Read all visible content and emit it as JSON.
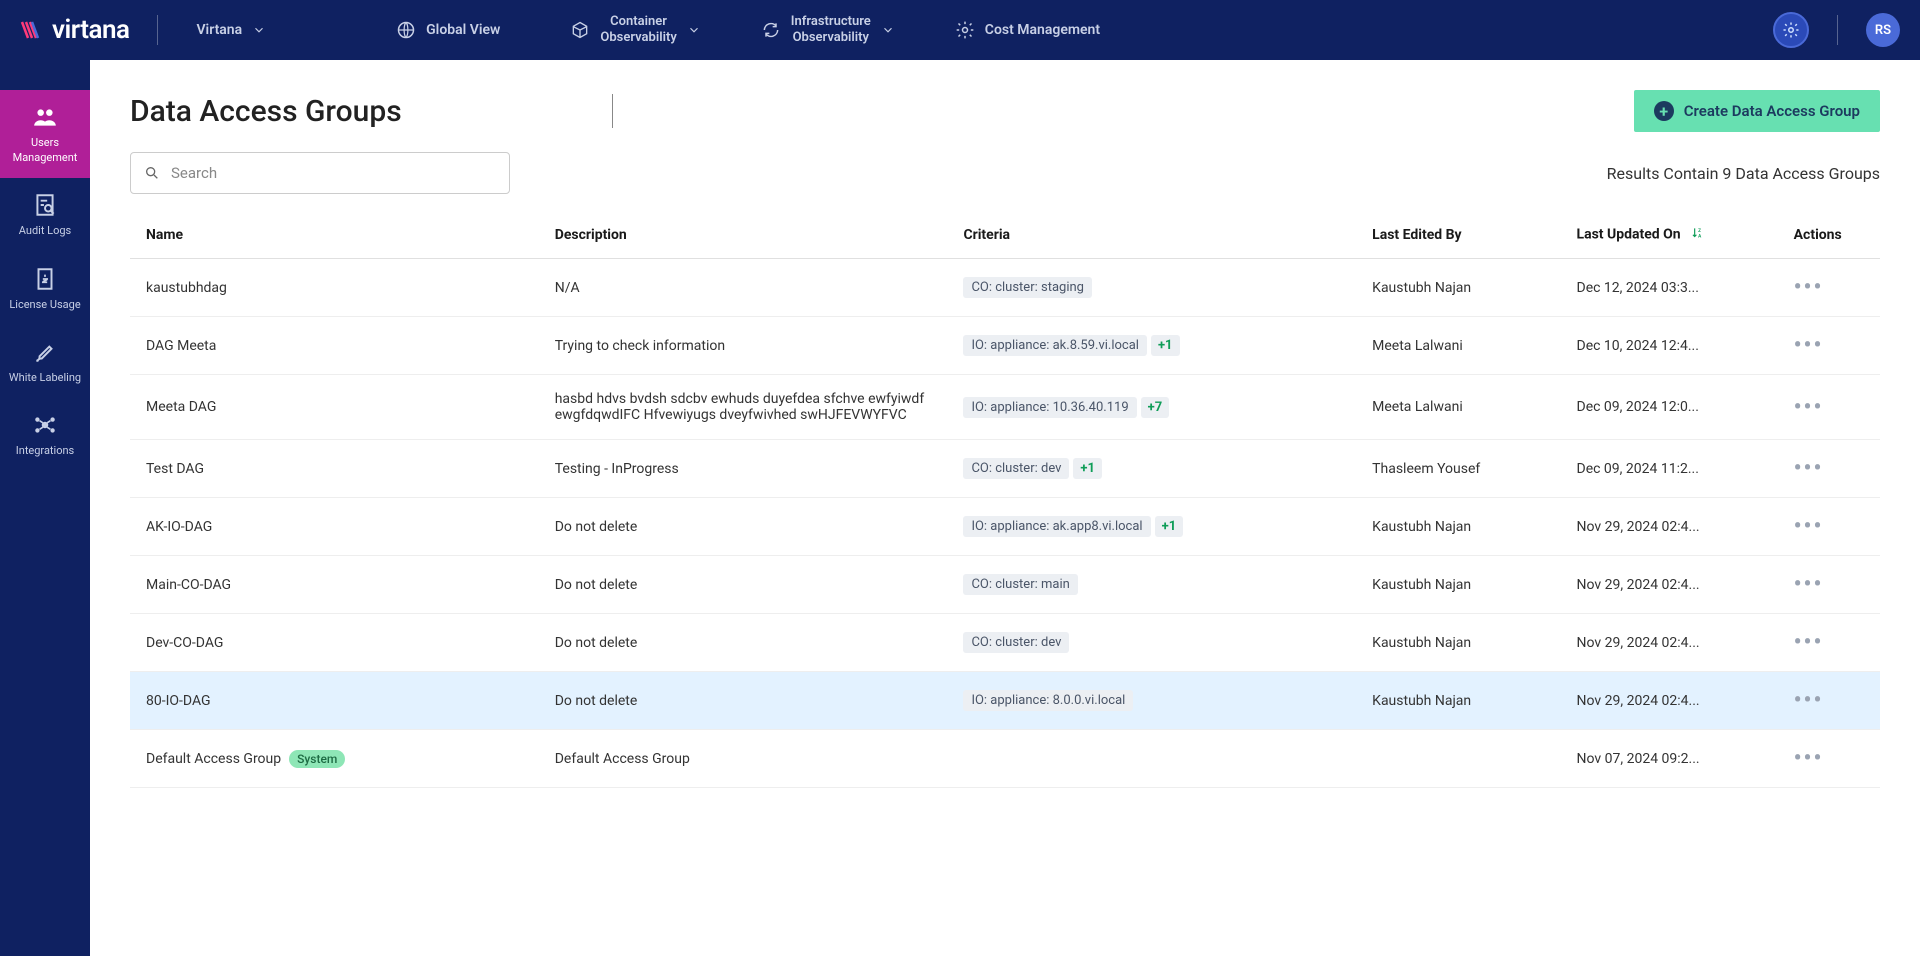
{
  "brand": "virtana",
  "topnav": {
    "org": "Virtana",
    "items": [
      {
        "label": "Global View"
      },
      {
        "label_line1": "Container",
        "label_line2": "Observability"
      },
      {
        "label_line1": "Infrastructure",
        "label_line2": "Observability"
      },
      {
        "label": "Cost Management"
      }
    ],
    "avatar": "RS"
  },
  "sidebar": {
    "items": [
      {
        "label_line1": "Users",
        "label_line2": "Management"
      },
      {
        "label": "Audit Logs"
      },
      {
        "label": "License Usage"
      },
      {
        "label": "White Labeling"
      },
      {
        "label": "Integrations"
      }
    ]
  },
  "page": {
    "title": "Data Access Groups",
    "create_button": "Create Data Access Group",
    "search_placeholder": "Search",
    "results_text": "Results Contain 9 Data Access Groups"
  },
  "table": {
    "headers": {
      "name": "Name",
      "description": "Description",
      "criteria": "Criteria",
      "edited_by": "Last Edited By",
      "updated_on": "Last Updated On",
      "actions": "Actions"
    },
    "rows": [
      {
        "name": "kaustubhdag",
        "description": "N/A",
        "criteria": "CO: cluster: staging",
        "more": "",
        "edited_by": "Kaustubh Najan",
        "updated_on": "Dec 12, 2024 03:3..."
      },
      {
        "name": "DAG Meeta",
        "description": "Trying to check information",
        "criteria": "IO: appliance: ak.8.59.vi.local",
        "more": "+1",
        "edited_by": "Meeta Lalwani",
        "updated_on": "Dec 10, 2024 12:4..."
      },
      {
        "name": "Meeta DAG",
        "description": "hasbd hdvs bvdsh sdcbv ewhuds duyefdea sfchve ewfyiwdf ewgfdqwdIFC Hfvewiyugs dveyfwivhed swHJFEVWYFVC",
        "criteria": "IO: appliance: 10.36.40.119",
        "more": "+7",
        "edited_by": "Meeta Lalwani",
        "updated_on": "Dec 09, 2024 12:0..."
      },
      {
        "name": "Test DAG",
        "description": "Testing - InProgress",
        "criteria": "CO: cluster: dev",
        "more": "+1",
        "edited_by": "Thasleem Yousef",
        "updated_on": "Dec 09, 2024 11:2..."
      },
      {
        "name": "AK-IO-DAG",
        "description": "Do not delete",
        "criteria": "IO: appliance: ak.app8.vi.local",
        "more": "+1",
        "edited_by": "Kaustubh Najan",
        "updated_on": "Nov 29, 2024 02:4..."
      },
      {
        "name": "Main-CO-DAG",
        "description": "Do not delete",
        "criteria": "CO: cluster: main",
        "more": "",
        "edited_by": "Kaustubh Najan",
        "updated_on": "Nov 29, 2024 02:4..."
      },
      {
        "name": "Dev-CO-DAG",
        "description": "Do not delete",
        "criteria": "CO: cluster: dev",
        "more": "",
        "edited_by": "Kaustubh Najan",
        "updated_on": "Nov 29, 2024 02:4..."
      },
      {
        "name": "80-IO-DAG",
        "description": "Do not delete",
        "criteria": "IO: appliance: 8.0.0.vi.local",
        "more": "",
        "edited_by": "Kaustubh Najan",
        "updated_on": "Nov 29, 2024 02:4...",
        "highlight": true
      },
      {
        "name": "Default Access Group",
        "description": "Default Access Group",
        "criteria": "",
        "more": "",
        "edited_by": "",
        "updated_on": "Nov 07, 2024 09:2...",
        "system": "System"
      }
    ]
  }
}
